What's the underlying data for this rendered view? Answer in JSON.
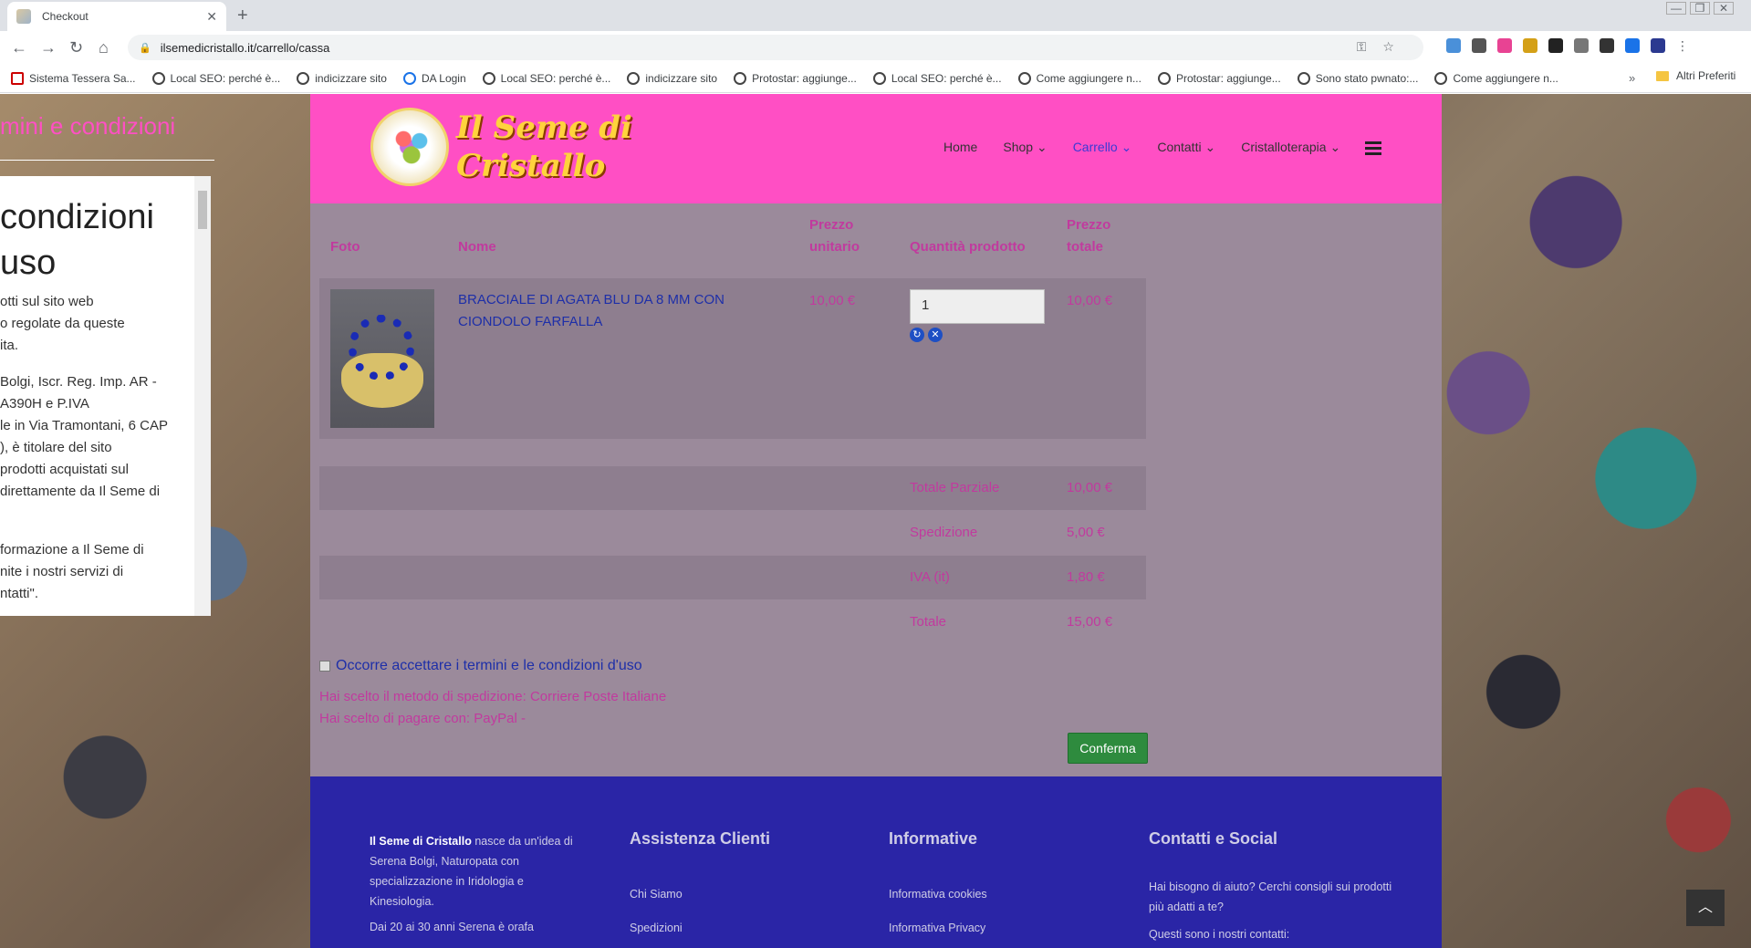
{
  "browser": {
    "tab_title": "Checkout",
    "url": "ilsemedicristallo.it/carrello/cassa",
    "bookmarks": [
      "Sistema Tessera Sa...",
      "Local SEO: perché è...",
      "indicizzare sito",
      "DA Login",
      "Local SEO: perché è...",
      "indicizzare sito",
      "Protostar: aggiunge...",
      "Local SEO: perché è...",
      "Come aggiungere n...",
      "Protostar: aggiunge...",
      "Sono stato pwnato:...",
      "Come aggiungere n..."
    ],
    "other_bookmarks": "Altri Preferiti"
  },
  "terms_overlay": {
    "title": "mini e condizioni",
    "heading_l1": "condizioni",
    "heading_l2": "uso",
    "lines": [
      "otti sul sito web",
      "o regolate da queste",
      "ita.",
      "",
      "Bolgi, Iscr. Reg. Imp. AR -",
      "A390H e P.IVA",
      "le in Via Tramontani, 6 CAP",
      "), è titolare del sito",
      "prodotti acquistati sul",
      "direttamente da Il Seme di",
      "",
      "",
      "formazione a Il Seme di",
      "nite i nostri servizi di",
      "ntatti\"."
    ]
  },
  "header": {
    "logo_line1": "Il Seme di",
    "logo_line2": "Cristallo",
    "menu": [
      "Home",
      "Shop",
      "Carrello",
      "Contatti",
      "Cristalloterapia"
    ]
  },
  "cart": {
    "col_foto": "Foto",
    "col_nome": "Nome",
    "col_prezzo_unitario_1": "Prezzo",
    "col_prezzo_unitario_2": "unitario",
    "col_quantita": "Quantità prodotto",
    "col_prezzo_totale_1": "Prezzo",
    "col_prezzo_totale_2": "totale",
    "product_name": "BRACCIALE DI AGATA BLU DA 8 MM CON CIONDOLO FARFALLA",
    "unit_price": "10,00 €",
    "quantity": "1",
    "total_price": "10,00 €",
    "subtotal_label": "Totale Parziale",
    "subtotal_value": "10,00 €",
    "shipping_label": "Spedizione",
    "shipping_value": "5,00 €",
    "vat_label": "IVA (it)",
    "vat_value": "1,80 €",
    "total_label": "Totale",
    "total_value": "15,00 €",
    "accept_terms": "Occorre accettare i termini e le condizioni d'uso",
    "shipping_method": "Hai scelto il metodo di spedizione: Corriere Poste Italiane",
    "payment_method": "Hai scelto di pagare con: PayPal -",
    "confirm_button": "Conferma"
  },
  "footer": {
    "about_brand": "Il Seme di Cristallo",
    "about_text": " nasce da un'idea di Serena Bolgi, Naturopata con specializzazione in Iridologia e Kinesiologia.",
    "about_text2": "Dai 20 ai 30 anni Serena è orafa",
    "col2_title": "Assistenza Clienti",
    "col2_links": [
      "Chi Siamo",
      "Spedizioni"
    ],
    "col3_title": "Informative",
    "col3_links": [
      "Informativa cookies",
      "Informativa Privacy"
    ],
    "col4_title": "Contatti e Social",
    "col4_text": "Hai bisogno di aiuto? Cerchi consigli sui prodotti più adatti a te?",
    "col4_text2": "Questi sono i nostri contatti:"
  }
}
